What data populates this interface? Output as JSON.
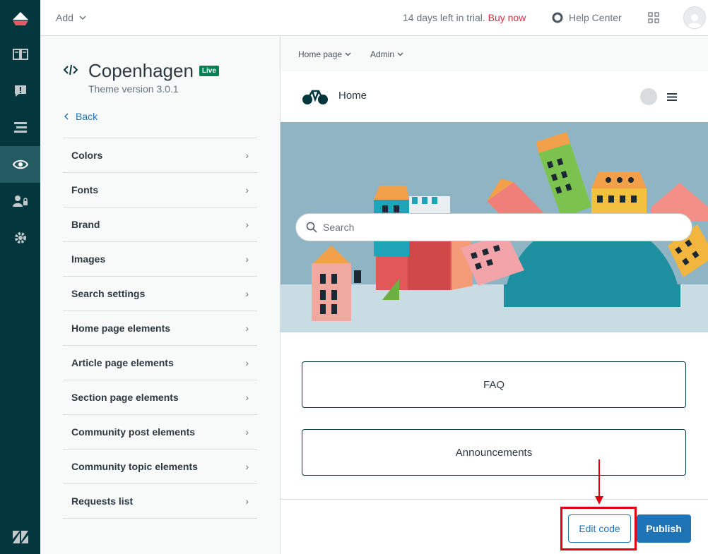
{
  "topbar": {
    "add_label": "Add",
    "trial_text": "14 days left in trial.",
    "buy_now": "Buy now",
    "help_center": "Help Center"
  },
  "panel": {
    "theme_name": "Copenhagen",
    "live_badge": "Live",
    "theme_version": "Theme version 3.0.1",
    "back_label": "Back",
    "menu": [
      {
        "label": "Colors"
      },
      {
        "label": "Fonts"
      },
      {
        "label": "Brand"
      },
      {
        "label": "Images"
      },
      {
        "label": "Search settings"
      },
      {
        "label": "Home page elements"
      },
      {
        "label": "Article page elements"
      },
      {
        "label": "Section page elements"
      },
      {
        "label": "Community post elements"
      },
      {
        "label": "Community topic elements"
      },
      {
        "label": "Requests list"
      }
    ]
  },
  "preview": {
    "page_select": "Home page",
    "role_select": "Admin",
    "home_label": "Home",
    "search_placeholder": "Search",
    "blocks": [
      "FAQ",
      "Announcements"
    ]
  },
  "footer": {
    "edit_code": "Edit code",
    "publish": "Publish"
  },
  "colors": {
    "rail": "#03363d",
    "accent": "#1f73b7",
    "live": "#038153",
    "highlight": "#e0000f"
  }
}
